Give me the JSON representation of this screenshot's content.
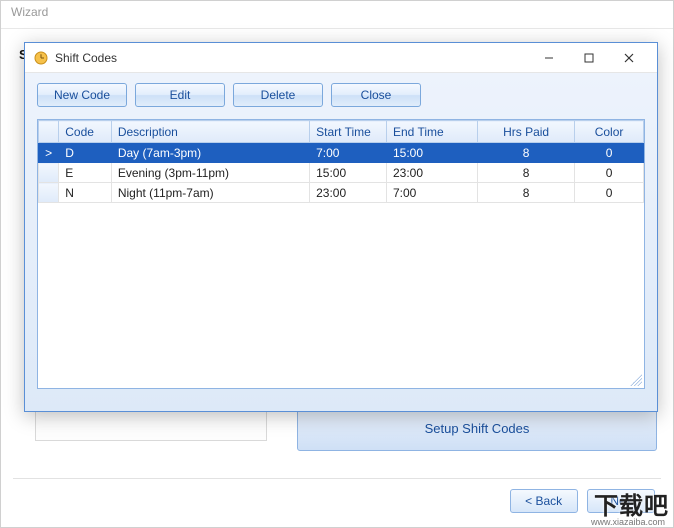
{
  "parent": {
    "title": "Wizard",
    "truncated_label": "S",
    "setup_button": "Setup Shift Codes",
    "back": "< Back",
    "next": "Nex"
  },
  "dialog": {
    "title": "Shift Codes",
    "toolbar": {
      "new_code": "New Code",
      "edit": "Edit",
      "delete": "Delete",
      "close": "Close"
    },
    "columns": {
      "code": "Code",
      "description": "Description",
      "start": "Start Time",
      "end": "End Time",
      "hrs": "Hrs Paid",
      "color": "Color"
    },
    "rows": [
      {
        "indicator": ">",
        "code": "D",
        "description": "Day (7am-3pm)",
        "start": "7:00",
        "end": "15:00",
        "hrs": "8",
        "color": "0",
        "selected": true
      },
      {
        "indicator": "",
        "code": "E",
        "description": "Evening (3pm-11pm)",
        "start": "15:00",
        "end": "23:00",
        "hrs": "8",
        "color": "0",
        "selected": false
      },
      {
        "indicator": "",
        "code": "N",
        "description": "Night (11pm-7am)",
        "start": "23:00",
        "end": "7:00",
        "hrs": "8",
        "color": "0",
        "selected": false
      }
    ]
  },
  "watermark": {
    "main": "下载吧",
    "sub": "www.xiazaiba.com"
  }
}
